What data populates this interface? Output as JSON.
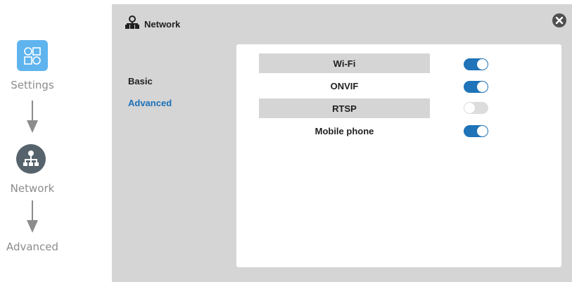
{
  "guide": {
    "step1_label": "Settings",
    "step2_label": "Network",
    "step3_label": "Advanced"
  },
  "panel": {
    "title": "Network",
    "nav": {
      "basic": "Basic",
      "advanced": "Advanced"
    },
    "rows": [
      {
        "label": "Wi-Fi",
        "enabled": true
      },
      {
        "label": "ONVIF",
        "enabled": true
      },
      {
        "label": "RTSP",
        "enabled": false
      },
      {
        "label": "Mobile phone",
        "enabled": true
      }
    ]
  },
  "colors": {
    "accent": "#1f73b8",
    "panel_bg": "#d5d5d5",
    "settings_tile": "#5fb4ee",
    "network_circle": "#56636c"
  },
  "icons": {
    "settings": "settings-grid-icon",
    "network": "network-icon",
    "close": "close-icon",
    "arrow": "arrow-down-icon"
  }
}
